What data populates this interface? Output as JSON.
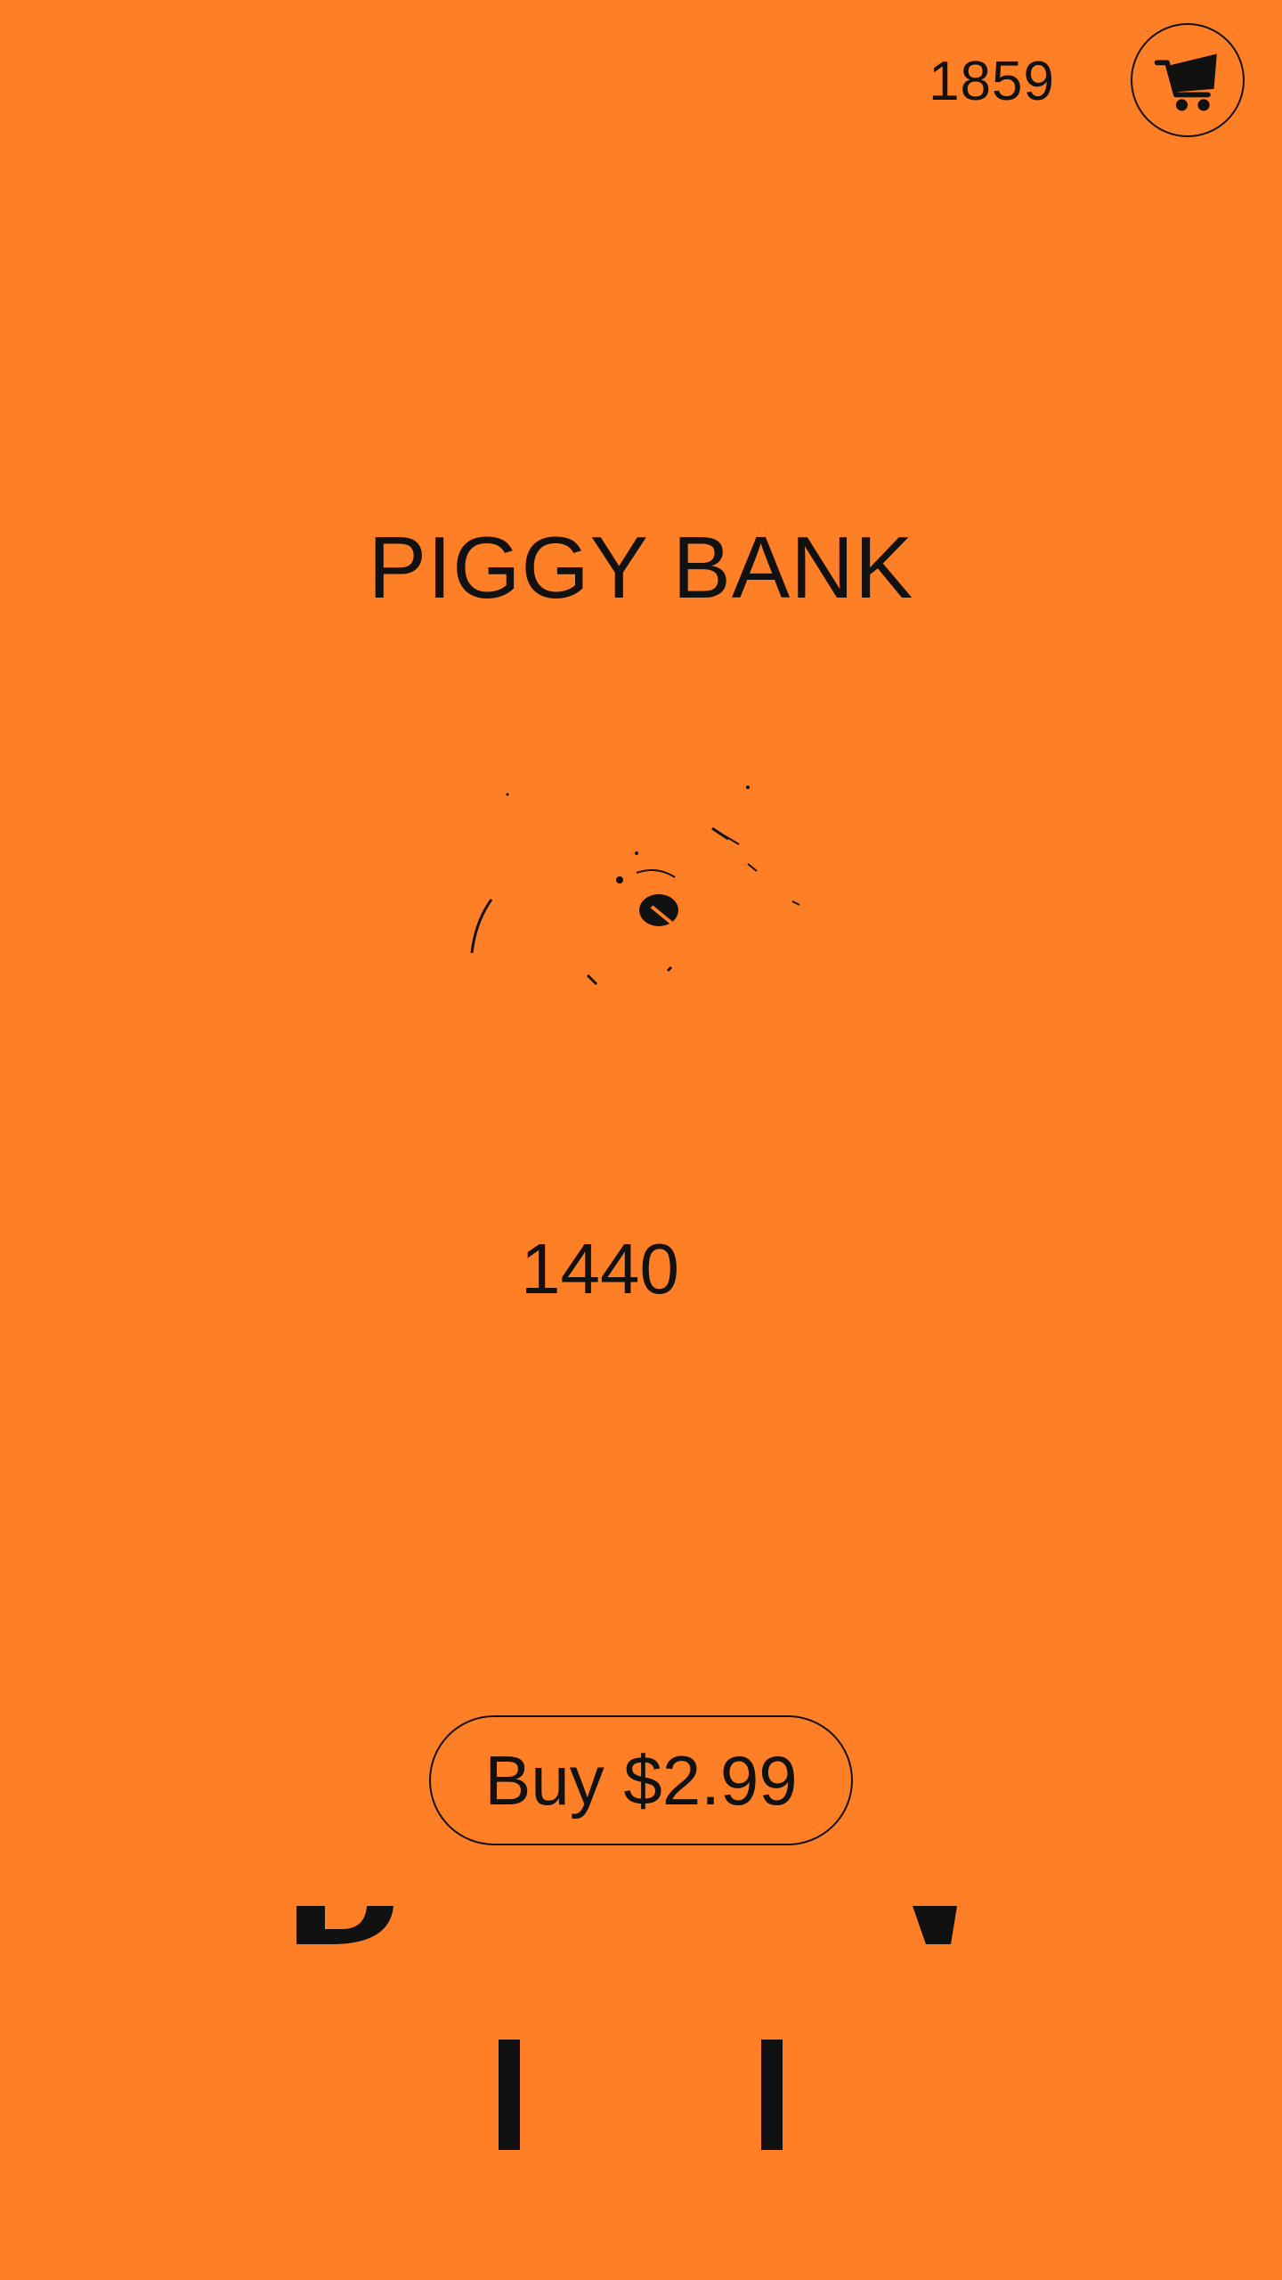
{
  "header": {
    "coins": "1859",
    "cart_icon": "shopping-cart-icon"
  },
  "product": {
    "title": "PIGGY BANK",
    "image_icon": "piggy-bank-icon",
    "amount": "1440",
    "buy_label": "Buy $2.99"
  },
  "colors": {
    "background": "#FF7F27",
    "foreground": "#111111"
  }
}
